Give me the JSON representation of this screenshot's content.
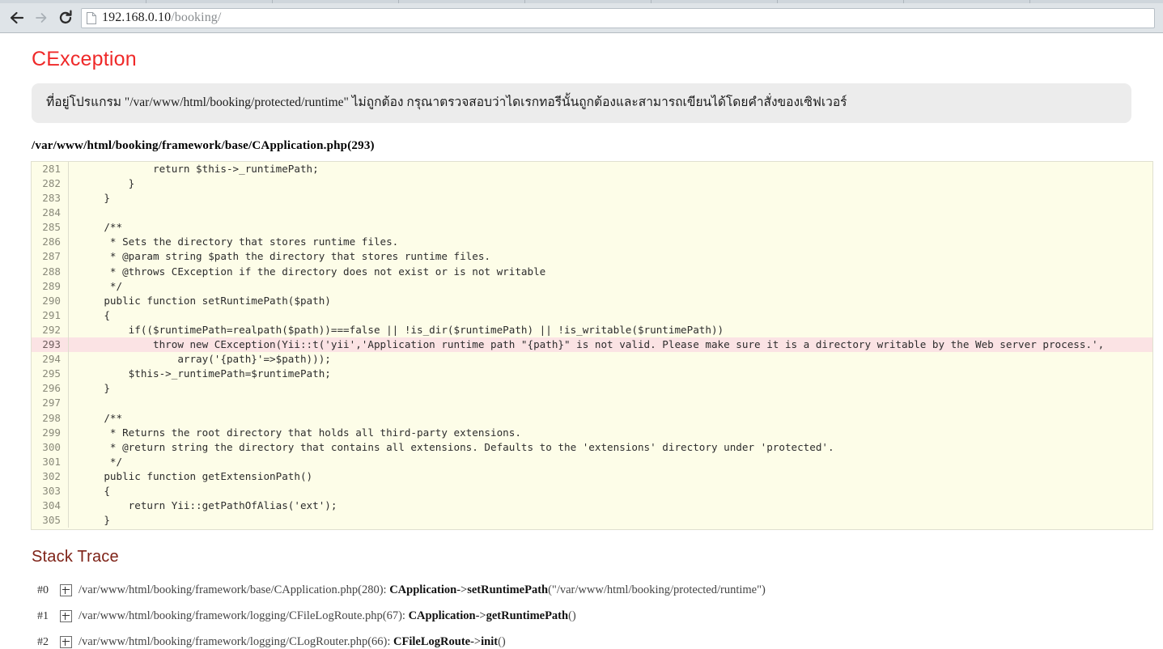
{
  "browser": {
    "back_icon": "back-arrow-icon",
    "forward_icon": "forward-arrow-icon",
    "reload_icon": "reload-icon",
    "page_icon": "page-document-icon",
    "url_host": "192.168.0.10",
    "url_path": "/booking/",
    "url_full": "192.168.0.10/booking/"
  },
  "page": {
    "error_title": "CException",
    "error_message": "ที่อยู่โปรแกรม \"/var/www/html/booking/protected/runtime\" ไม่ถูกต้อง กรุณาตรวจสอบว่าไดเรกทอรีนั้นถูกต้องและสามารถเขียนได้โดยคำสั่งของเซิฟเวอร์",
    "source_file": "/var/www/html/booking/framework/base/CApplication.php(293)",
    "stack_trace_heading": "Stack Trace"
  },
  "code": {
    "error_line": "293",
    "lines": [
      {
        "num": "281",
        "text": "            return $this->_runtimePath;",
        "error": false
      },
      {
        "num": "282",
        "text": "        }",
        "error": false
      },
      {
        "num": "283",
        "text": "    }",
        "error": false
      },
      {
        "num": "284",
        "text": "",
        "error": false
      },
      {
        "num": "285",
        "text": "    /**",
        "error": false
      },
      {
        "num": "286",
        "text": "     * Sets the directory that stores runtime files.",
        "error": false
      },
      {
        "num": "287",
        "text": "     * @param string $path the directory that stores runtime files.",
        "error": false
      },
      {
        "num": "288",
        "text": "     * @throws CException if the directory does not exist or is not writable",
        "error": false
      },
      {
        "num": "289",
        "text": "     */",
        "error": false
      },
      {
        "num": "290",
        "text": "    public function setRuntimePath($path)",
        "error": false
      },
      {
        "num": "291",
        "text": "    {",
        "error": false
      },
      {
        "num": "292",
        "text": "        if(($runtimePath=realpath($path))===false || !is_dir($runtimePath) || !is_writable($runtimePath))",
        "error": false
      },
      {
        "num": "293",
        "text": "            throw new CException(Yii::t('yii','Application runtime path \"{path}\" is not valid. Please make sure it is a directory writable by the Web server process.',",
        "error": true
      },
      {
        "num": "294",
        "text": "                array('{path}'=>$path)));",
        "error": false
      },
      {
        "num": "295",
        "text": "        $this->_runtimePath=$runtimePath;",
        "error": false
      },
      {
        "num": "296",
        "text": "    }",
        "error": false
      },
      {
        "num": "297",
        "text": "",
        "error": false
      },
      {
        "num": "298",
        "text": "    /**",
        "error": false
      },
      {
        "num": "299",
        "text": "     * Returns the root directory that holds all third-party extensions.",
        "error": false
      },
      {
        "num": "300",
        "text": "     * @return string the directory that contains all extensions. Defaults to the 'extensions' directory under 'protected'.",
        "error": false
      },
      {
        "num": "301",
        "text": "     */",
        "error": false
      },
      {
        "num": "302",
        "text": "    public function getExtensionPath()",
        "error": false
      },
      {
        "num": "303",
        "text": "    {",
        "error": false
      },
      {
        "num": "304",
        "text": "        return Yii::getPathOfAlias('ext');",
        "error": false
      },
      {
        "num": "305",
        "text": "    }",
        "error": false
      }
    ]
  },
  "stack_trace": [
    {
      "index": "#0",
      "path": "/var/www/html/booking/framework/base/CApplication.php(280):",
      "class": "CApplication",
      "arrow": "->",
      "method": "setRuntimePath",
      "args": "(\"/var/www/html/booking/protected/runtime\")"
    },
    {
      "index": "#1",
      "path": "/var/www/html/booking/framework/logging/CFileLogRoute.php(67):",
      "class": "CApplication",
      "arrow": "->",
      "method": "getRuntimePath",
      "args": "()"
    },
    {
      "index": "#2",
      "path": "/var/www/html/booking/framework/logging/CLogRouter.php(66):",
      "class": "CFileLogRoute",
      "arrow": "->",
      "method": "init",
      "args": "()"
    }
  ],
  "colors": {
    "error_title": "#ef2929",
    "stack_heading": "#7e2217",
    "message_bg": "#ececec",
    "code_bg": "#fdfde8",
    "error_line_bg": "#fbe3e4"
  }
}
